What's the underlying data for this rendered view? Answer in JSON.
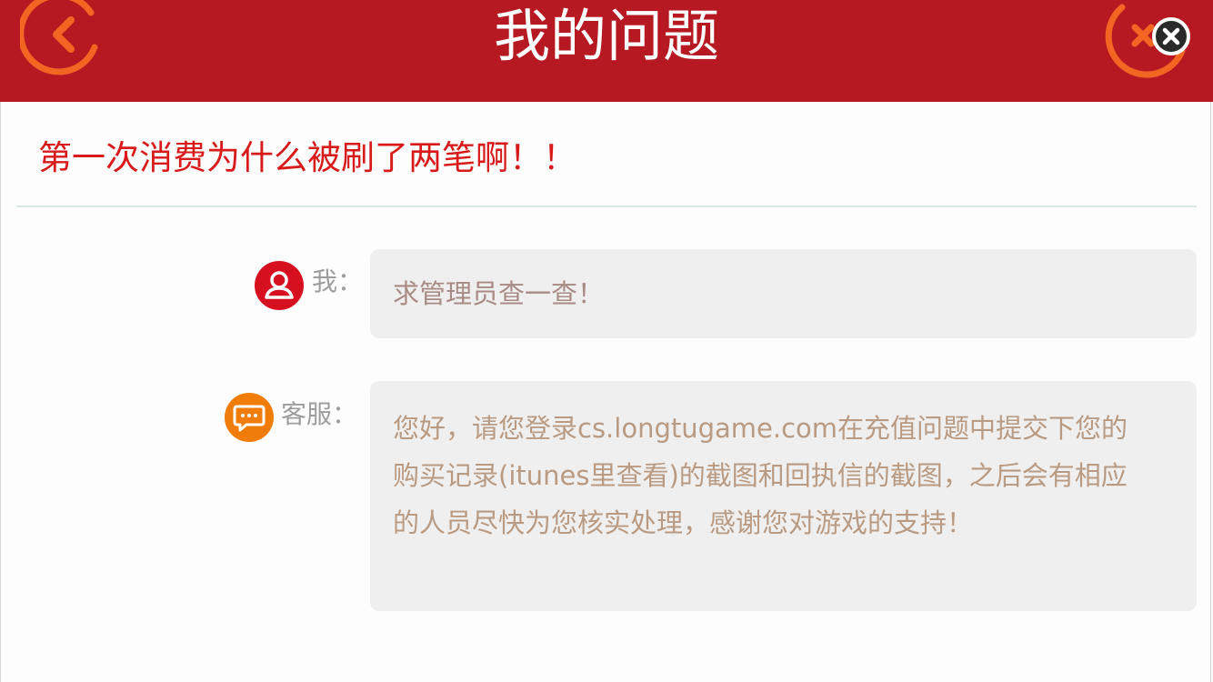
{
  "header": {
    "title": "我的问题",
    "back_icon": "chevron-left-icon",
    "close_icon": "close-icon",
    "accent_color": "#b71923",
    "ring_color": "#f26522"
  },
  "question": {
    "title": "第一次消费为什么被刷了两笔啊！！",
    "title_color": "#d81a1a"
  },
  "messages": [
    {
      "speaker": "我：",
      "avatar_icon": "user-icon",
      "avatar_color": "#d7101f",
      "text": "求管理员查一查！"
    },
    {
      "speaker": "客服：",
      "avatar_icon": "chat-icon",
      "avatar_color": "#f07d0a",
      "text": "您好，请您登录cs.longtugame.com在充值问题中提交下您的购买记录(itunes里查看)的截图和回执信的截图，之后会有相应的人员尽快为您核实处理，感谢您对游戏的支持！"
    }
  ]
}
